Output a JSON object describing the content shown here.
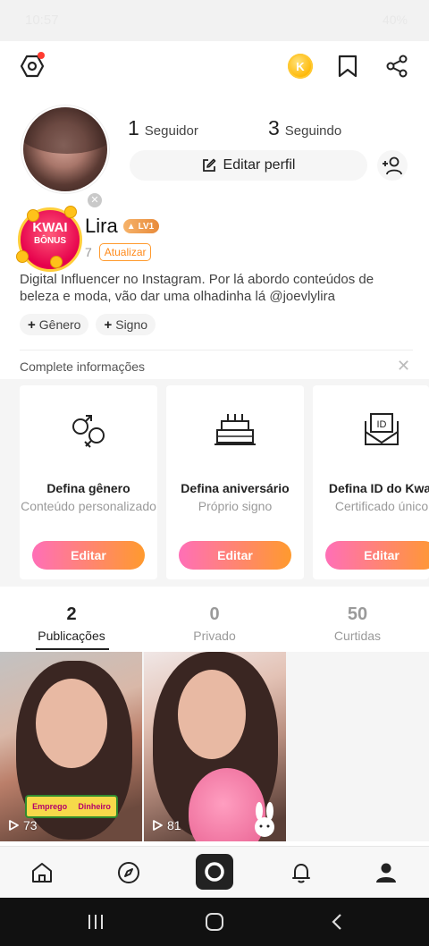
{
  "status_bar": {
    "time": "10:57",
    "battery": "40%"
  },
  "profile": {
    "followers_count": "1",
    "followers_label": "Seguidor",
    "following_count": "3",
    "following_label": "Seguindo",
    "edit_profile_label": "Editar perfil",
    "username": "Lira",
    "level": "LV1",
    "kwai_id_partial": "7",
    "update_label": "Atualizar",
    "bio": "Digital Influencer no Instagram. Por lá abordo conteúdos de beleza e moda, vão dar uma olhadinha lá @joevlylira",
    "chips": [
      "Gênero",
      "Signo"
    ]
  },
  "kwai_bonus": {
    "line1": "KWAI",
    "line2": "BÔNUS"
  },
  "complete_info": {
    "title": "Complete informações",
    "cards": [
      {
        "icon": "gender-icon",
        "title": "Defina gênero",
        "subtitle": "Conteúdo personalizado",
        "button": "Editar"
      },
      {
        "icon": "cake-icon",
        "title": "Defina aniversário",
        "subtitle": "Próprio signo",
        "button": "Editar"
      },
      {
        "icon": "id-card-icon",
        "title": "Defina ID do Kwai",
        "subtitle": "Certificado único",
        "button": "Editar"
      }
    ]
  },
  "tabs": [
    {
      "count": "2",
      "label": "Publicações",
      "active": true
    },
    {
      "count": "0",
      "label": "Privado",
      "active": false
    },
    {
      "count": "50",
      "label": "Curtidas",
      "active": false
    }
  ],
  "videos": [
    {
      "plays": "73",
      "overlay_text_left": "Emprego",
      "overlay_text_right": "Dinheiro"
    },
    {
      "plays": "81"
    }
  ],
  "bottom_nav": [
    "home-icon",
    "discover-icon",
    "camera-icon",
    "notifications-icon",
    "profile-icon"
  ],
  "colors": {
    "accent_start": "#ff6fb7",
    "accent_end": "#ff9a2e",
    "coin": "#ffb600",
    "level_badge": "#e88a3a"
  }
}
